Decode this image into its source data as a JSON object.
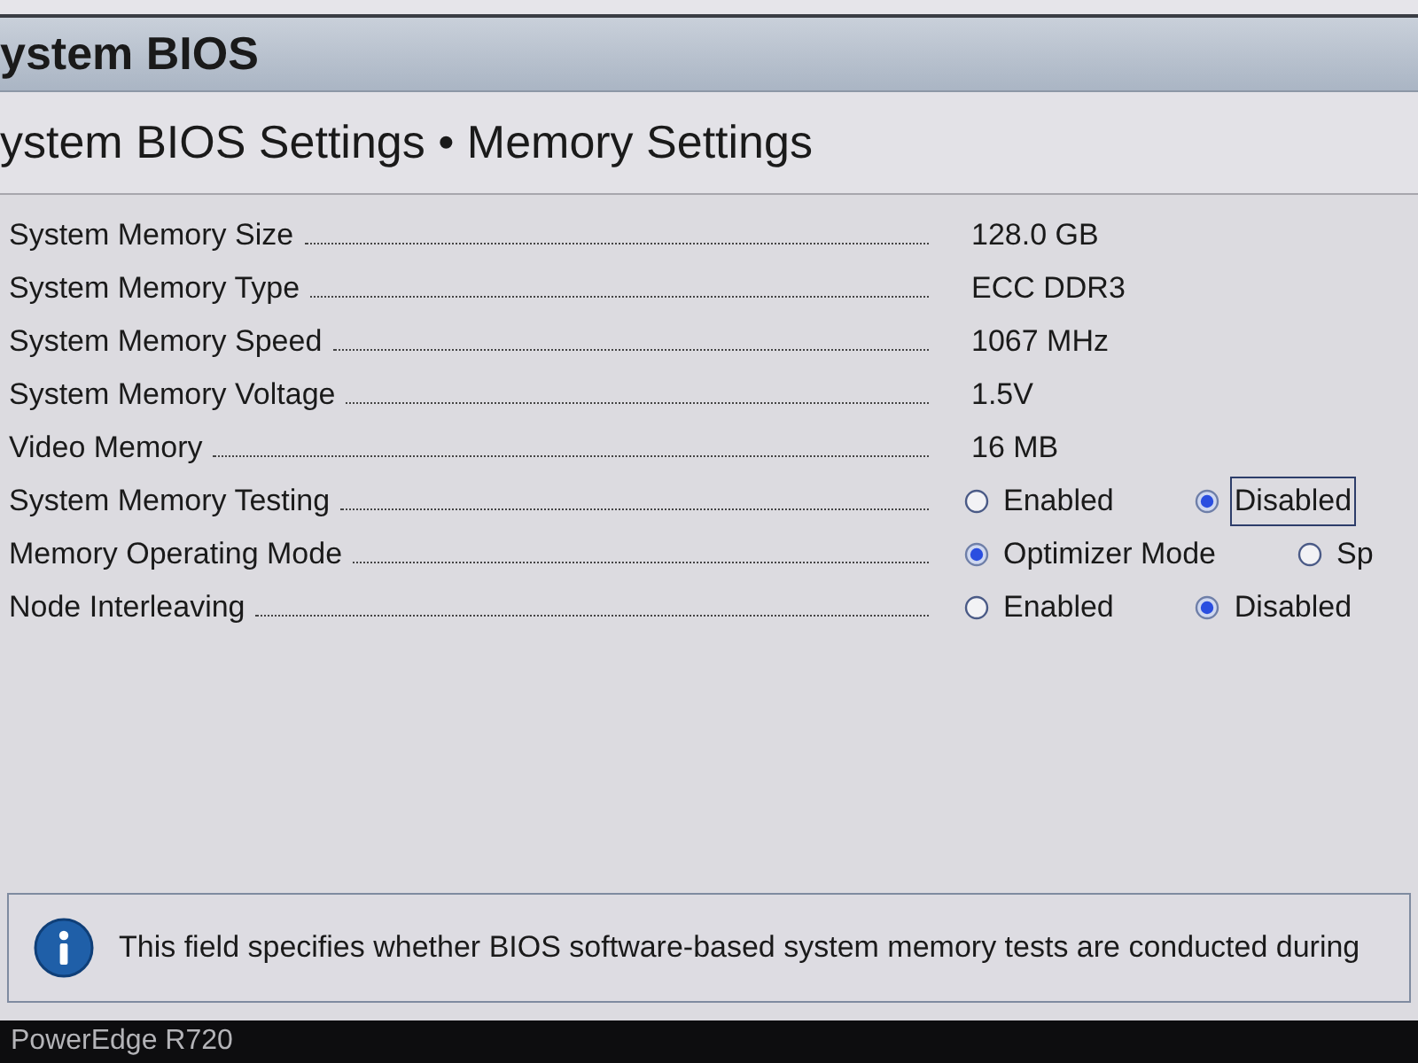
{
  "window": {
    "title": "ystem BIOS"
  },
  "breadcrumb": "ystem BIOS Settings • Memory Settings",
  "settings": [
    {
      "label": "System Memory Size",
      "kind": "value",
      "value": "128.0 GB"
    },
    {
      "label": "System Memory Type",
      "kind": "value",
      "value": "ECC DDR3"
    },
    {
      "label": "System Memory Speed",
      "kind": "value",
      "value": "1067 MHz"
    },
    {
      "label": "System Memory Voltage",
      "kind": "value",
      "value": "1.5V"
    },
    {
      "label": "Video Memory",
      "kind": "value",
      "value": "16 MB"
    },
    {
      "label": "System Memory Testing",
      "kind": "radio",
      "options": [
        {
          "label": "Enabled",
          "selected": false,
          "focused": false
        },
        {
          "label": "Disabled",
          "selected": true,
          "focused": true
        }
      ]
    },
    {
      "label": "Memory Operating Mode",
      "kind": "radio",
      "options": [
        {
          "label": "Optimizer Mode",
          "selected": true,
          "focused": false
        },
        {
          "label": "Sp",
          "selected": false,
          "focused": false
        }
      ]
    },
    {
      "label": "Node Interleaving",
      "kind": "radio",
      "options": [
        {
          "label": "Enabled",
          "selected": false,
          "focused": false
        },
        {
          "label": "Disabled",
          "selected": true,
          "focused": false
        }
      ]
    }
  ],
  "help": {
    "text": "This field specifies whether BIOS software-based system memory tests are conducted during"
  },
  "status_bar": {
    "model": "PowerEdge R720"
  }
}
